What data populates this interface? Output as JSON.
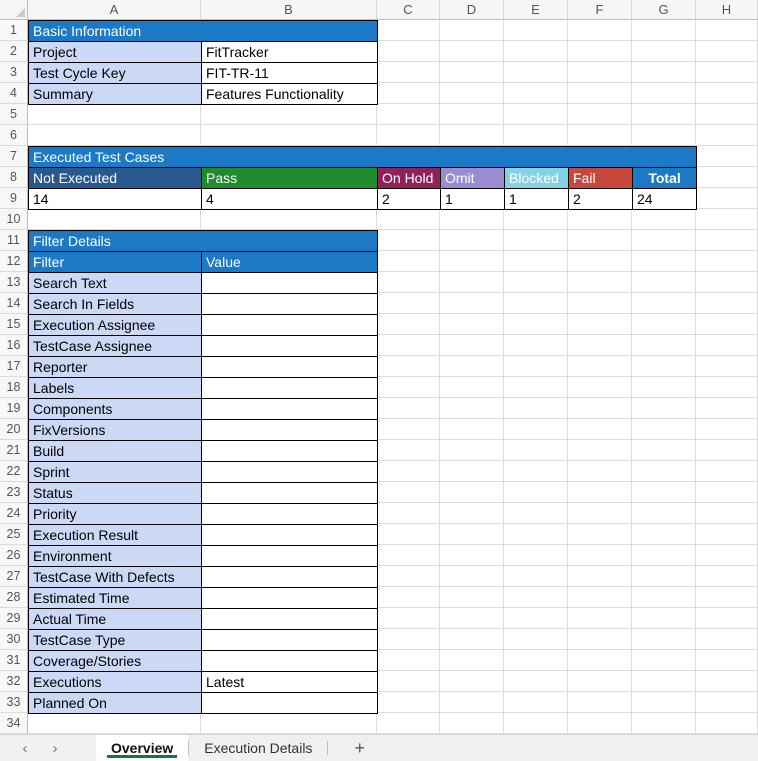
{
  "sheet": {
    "column_headers": [
      "A",
      "B",
      "C",
      "D",
      "E",
      "F",
      "G",
      "H"
    ],
    "row_count": 34
  },
  "colors": {
    "header_blue": "#1B79C5",
    "label_fill": "#CBD9F7",
    "tab_active_underline": "#1E7145"
  },
  "basic_info": {
    "title": "Basic Information",
    "rows": [
      {
        "label": "Project",
        "value": "FitTracker"
      },
      {
        "label": "Test Cycle Key",
        "value": "FIT-TR-11"
      },
      {
        "label": "Summary",
        "value": "Features Functionality"
      }
    ]
  },
  "executed_test_cases": {
    "title": "Executed Test Cases",
    "statuses": [
      {
        "label": "Not Executed",
        "count": "14",
        "fill": "#27598E"
      },
      {
        "label": "Pass",
        "count": "4",
        "fill": "#1F8B2C"
      },
      {
        "label": "On Hold",
        "count": "2",
        "fill": "#8E2155"
      },
      {
        "label": "Omit",
        "count": "1",
        "fill": "#9B8CD0"
      },
      {
        "label": "Blocked",
        "count": "1",
        "fill": "#84D2E4"
      },
      {
        "label": "Fail",
        "count": "2",
        "fill": "#C8473C"
      },
      {
        "label": "Total",
        "count": "24",
        "fill": "#1B79C5",
        "bold": true
      }
    ]
  },
  "filter_details": {
    "title": "Filter Details",
    "columns": [
      "Filter",
      "Value"
    ],
    "rows": [
      {
        "label": "Search Text",
        "value": ""
      },
      {
        "label": "Search In Fields",
        "value": ""
      },
      {
        "label": "Execution Assignee",
        "value": ""
      },
      {
        "label": "TestCase Assignee",
        "value": ""
      },
      {
        "label": "Reporter",
        "value": ""
      },
      {
        "label": "Labels",
        "value": ""
      },
      {
        "label": "Components",
        "value": ""
      },
      {
        "label": "FixVersions",
        "value": ""
      },
      {
        "label": "Build",
        "value": ""
      },
      {
        "label": "Sprint",
        "value": ""
      },
      {
        "label": "Status",
        "value": ""
      },
      {
        "label": "Priority",
        "value": ""
      },
      {
        "label": "Execution Result",
        "value": ""
      },
      {
        "label": "Environment",
        "value": ""
      },
      {
        "label": "TestCase With Defects",
        "value": ""
      },
      {
        "label": "Estimated Time",
        "value": ""
      },
      {
        "label": "Actual Time",
        "value": ""
      },
      {
        "label": "TestCase Type",
        "value": ""
      },
      {
        "label": "Coverage/Stories",
        "value": ""
      },
      {
        "label": "Executions",
        "value": "Latest"
      },
      {
        "label": "Planned On",
        "value": ""
      }
    ]
  },
  "sheet_tabs": {
    "prev_icon": "‹",
    "next_icon": "›",
    "tabs": [
      {
        "label": "Overview",
        "active": true
      },
      {
        "label": "Execution Details",
        "active": false
      }
    ],
    "add_label": "+"
  }
}
